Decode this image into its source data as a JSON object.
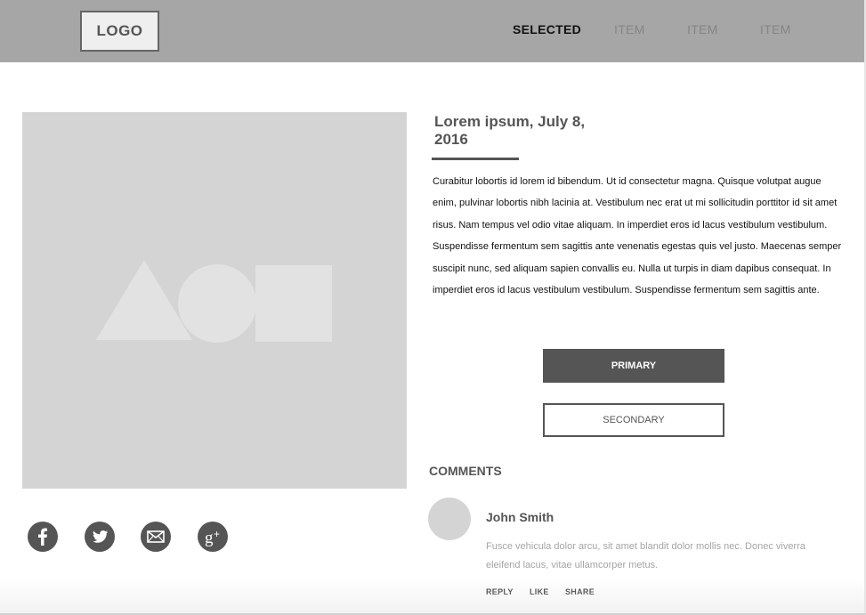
{
  "header": {
    "logo": "LOGO",
    "nav": [
      "SELECTED",
      "ITEM",
      "ITEM",
      "ITEM"
    ]
  },
  "hero": {
    "icon": "image-placeholder-icon"
  },
  "social": [
    {
      "icon": "facebook-icon"
    },
    {
      "icon": "twitter-icon"
    },
    {
      "icon": "email-icon"
    },
    {
      "icon": "google-plus-icon"
    }
  ],
  "article": {
    "title": "Lorem ipsum, July 8, 2016",
    "body": "Curabitur lobortis id lorem id bibendum. Ut id consectetur magna. Quisque volutpat augue enim, pulvinar lobortis nibh lacinia at. Vestibulum nec erat ut mi sollicitudin porttitor id sit amet risus. Nam tempus vel odio vitae aliquam. In imperdiet eros id lacus vestibulum vestibulum. Suspendisse fermentum sem sagittis ante venenatis egestas quis vel justo. Maecenas semper suscipit nunc, sed aliquam sapien convallis eu. Nulla ut turpis in diam dapibus consequat. In imperdiet eros id lacus vestibulum vestibulum. Suspendisse fermentum sem sagittis ante."
  },
  "buttons": {
    "primary": "PRIMARY",
    "secondary": "SECONDARY"
  },
  "comments": {
    "heading": "COMMENTS",
    "items": [
      {
        "author": "John Smith",
        "text": "Fusce vehicula dolor arcu, sit amet blandit dolor mollis nec. Donec viverra eleifend lacus, vitae ullamcorper metus.",
        "actions": [
          "REPLY",
          "LIKE",
          "SHARE"
        ]
      }
    ]
  },
  "colors": {
    "header_bg": "#a6a6a6",
    "dark": "#555555",
    "placeholder": "#d4d4d4"
  }
}
